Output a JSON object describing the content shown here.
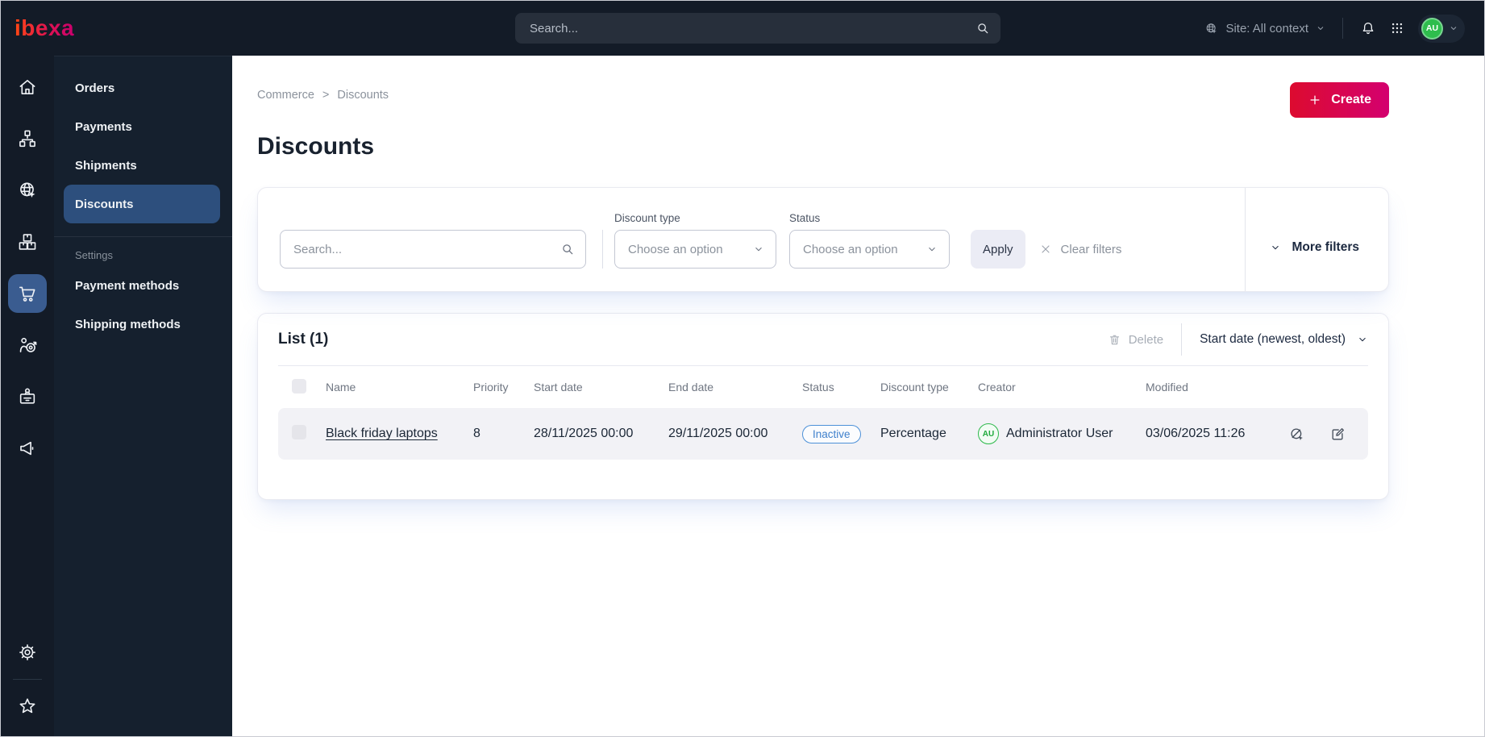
{
  "topbar": {
    "logo_text": "ibexa",
    "search_placeholder": "Search...",
    "site_label": "Site: All context",
    "avatar_initials": "AU"
  },
  "rail": {
    "items": [
      {
        "icon": "home-icon",
        "active": false
      },
      {
        "icon": "sitemap-icon",
        "active": false
      },
      {
        "icon": "site-globe-icon",
        "active": false
      },
      {
        "icon": "products-boxes-icon",
        "active": false
      },
      {
        "icon": "commerce-cart-icon",
        "active": true
      },
      {
        "icon": "audience-target-icon",
        "active": false
      },
      {
        "icon": "id-badge-icon",
        "active": false
      },
      {
        "icon": "megaphone-icon",
        "active": false
      }
    ],
    "bottom_items": [
      {
        "icon": "gear-icon"
      },
      {
        "icon": "star-icon"
      }
    ]
  },
  "sidebar": {
    "items": [
      {
        "label": "Orders",
        "active": false
      },
      {
        "label": "Payments",
        "active": false
      },
      {
        "label": "Shipments",
        "active": false
      },
      {
        "label": "Discounts",
        "active": true
      }
    ],
    "section_label": "Settings",
    "settings_items": [
      {
        "label": "Payment methods"
      },
      {
        "label": "Shipping methods"
      }
    ]
  },
  "breadcrumb": {
    "items": [
      "Commerce",
      "Discounts"
    ],
    "separator": ">"
  },
  "page": {
    "title": "Discounts"
  },
  "actions": {
    "create_label": "Create"
  },
  "filters": {
    "search_placeholder": "Search...",
    "discount_type_label": "Discount type",
    "discount_type_value": "Choose an option",
    "status_label": "Status",
    "status_value": "Choose an option",
    "apply_label": "Apply",
    "clear_label": "Clear filters",
    "more_label": "More filters"
  },
  "list": {
    "title": "List (1)",
    "delete_label": "Delete",
    "sort_label": "Start date (newest, oldest)",
    "columns": [
      "Name",
      "Priority",
      "Start date",
      "End date",
      "Status",
      "Discount type",
      "Creator",
      "Modified"
    ],
    "rows": [
      {
        "name": "Black friday laptops",
        "priority": "8",
        "start_date": "28/11/2025 00:00",
        "end_date": "29/11/2025 00:00",
        "status": "Inactive",
        "discount_type": "Percentage",
        "creator_initials": "AU",
        "creator": "Administrator User",
        "modified": "03/06/2025 11:26"
      }
    ]
  },
  "colors": {
    "topbar_bg": "#131b27",
    "sidebar_bg": "#15202e",
    "active_nav_blue": "#2d4f7d",
    "accent_gradient_start": "#dc0b2f",
    "accent_gradient_end": "#d4006f",
    "badge_inactive_blue": "#4d91d8",
    "avatar_green": "#2ebd4d"
  }
}
